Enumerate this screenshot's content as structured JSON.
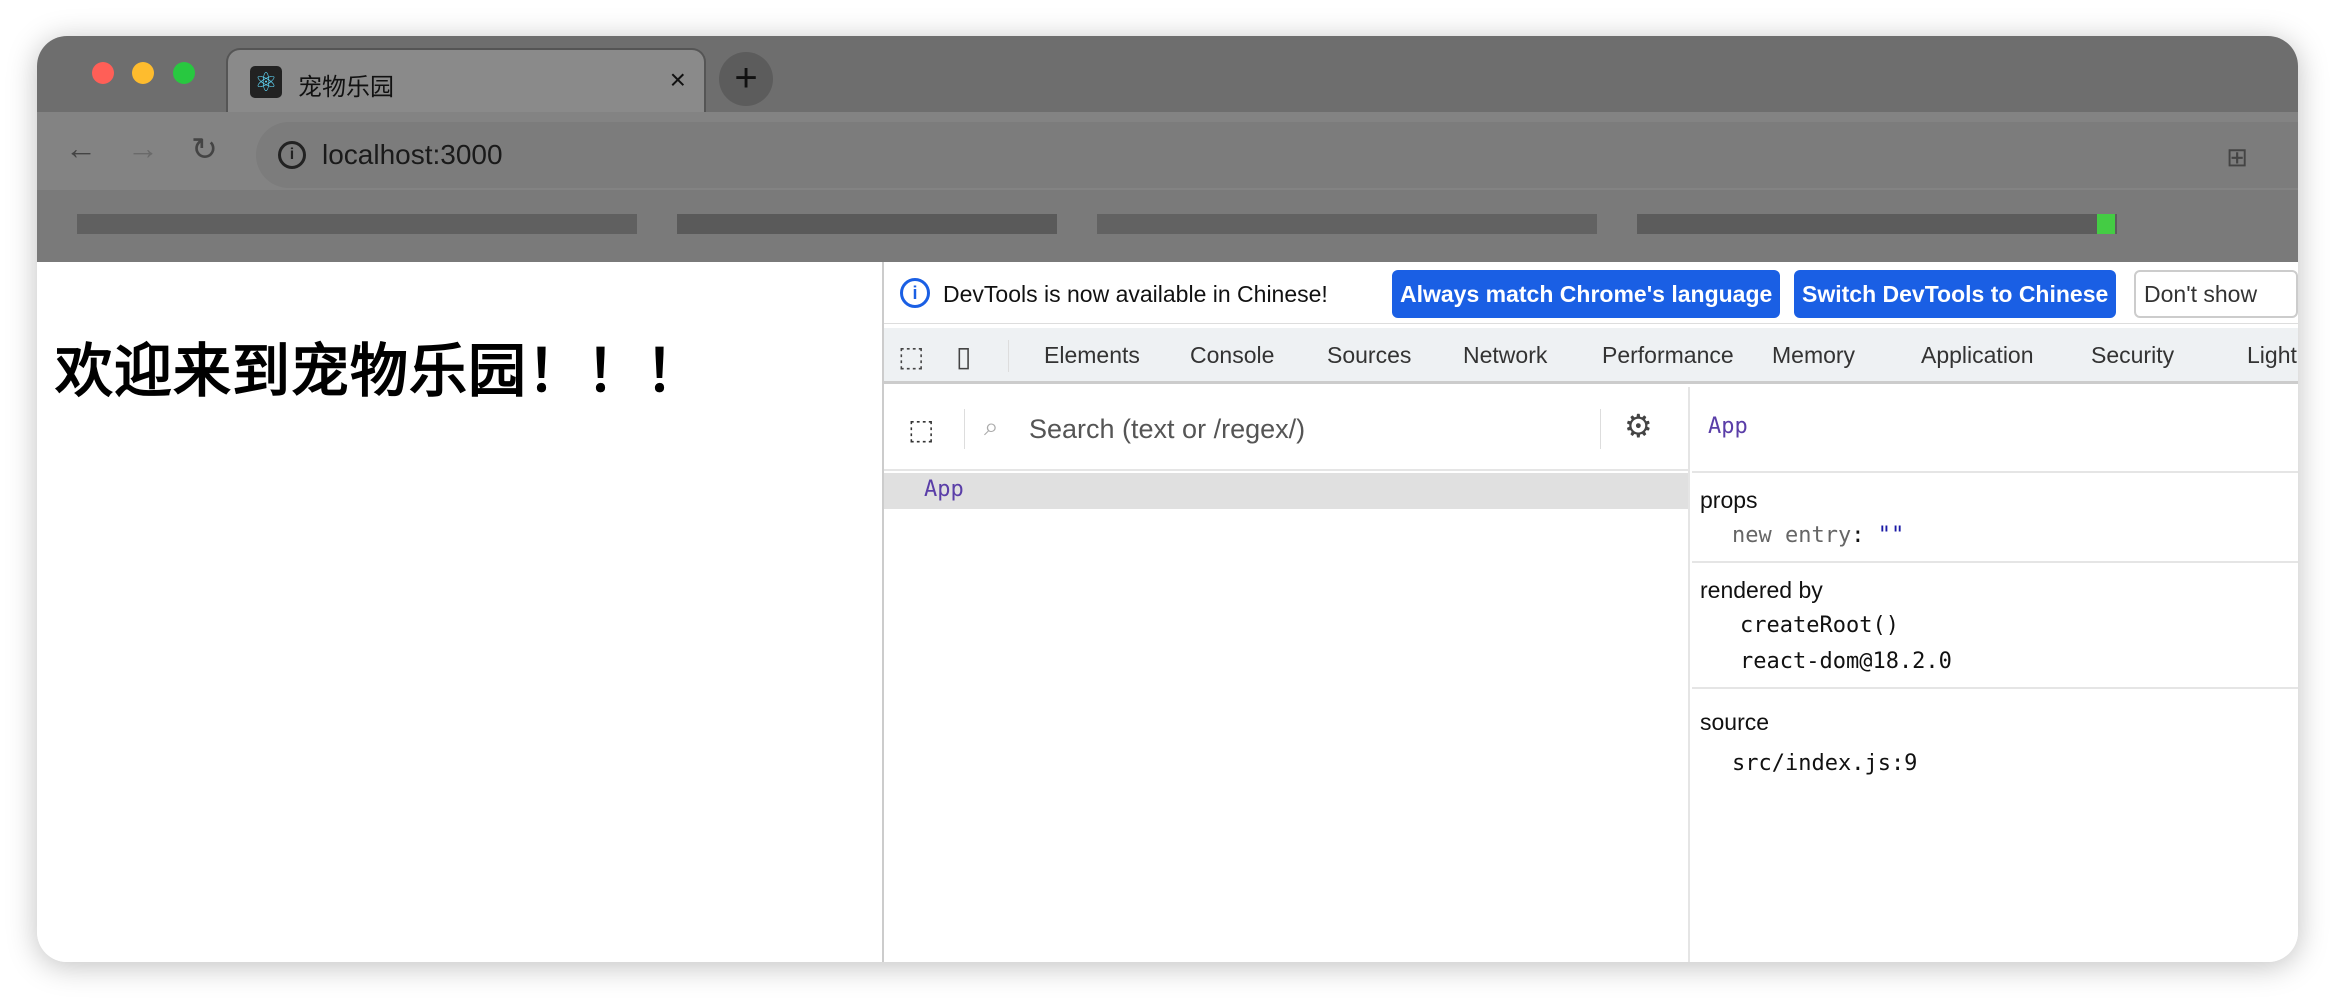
{
  "browser": {
    "tab_title": "宠物乐园",
    "url": "localhost:3000",
    "colors": {
      "close": "#ff5f57",
      "minimize": "#febc2e",
      "maximize": "#28c840"
    }
  },
  "page": {
    "heading": "欢迎来到宠物乐园！！！"
  },
  "devtools": {
    "infobar": {
      "message": "DevTools is now available in Chinese!",
      "match_button": "Always match Chrome's language",
      "switch_button": "Switch DevTools to Chinese",
      "dismiss_button": "Don't show again"
    },
    "tabs": [
      "Elements",
      "Console",
      "Sources",
      "Network",
      "Performance",
      "Memory",
      "Application",
      "Security",
      "Light"
    ],
    "components": {
      "search_placeholder": "Search (text or /regex/)",
      "tree": [
        {
          "label": "App",
          "selected": true
        }
      ],
      "selected_name": "App",
      "props_label": "props",
      "new_entry_key": "new entry",
      "new_entry_value": "\"\"",
      "rendered_by_label": "rendered by",
      "rendered_by": [
        "createRoot()",
        "react-dom@18.2.0"
      ],
      "source_label": "source",
      "source": "src/index.js:9"
    },
    "accent": "#1a5fe4"
  }
}
